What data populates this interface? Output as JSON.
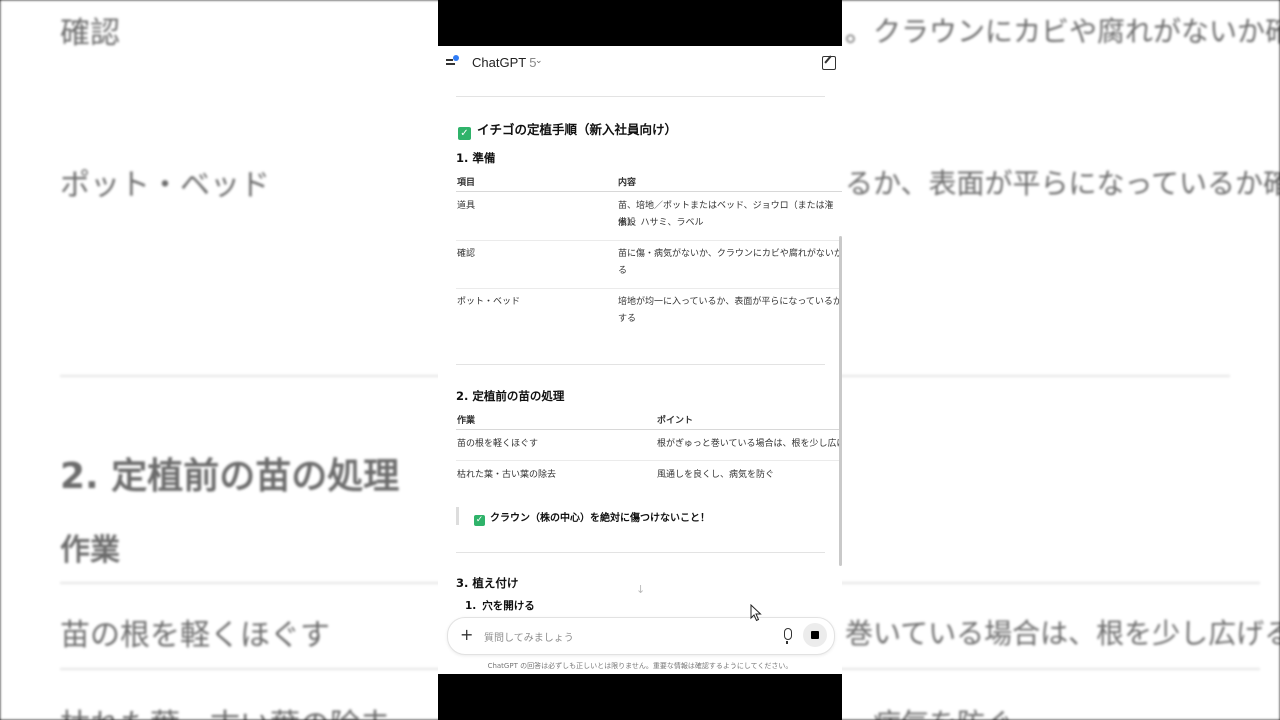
{
  "background": {
    "texts": [
      "確認",
      "ポット・ベッド",
      "2. 定植前の苗の処理",
      "作業",
      "苗の根を軽くほぐす",
      "枯れた葉・古い葉の除去"
    ],
    "right_texts": [
      "。クラウンにカビや腐れがないか確認",
      "るか、表面が平らになっているか確認",
      "巻いている場合は、根を少し広げる",
      "、病気を防ぐ"
    ]
  },
  "app": {
    "title": "ChatGPT",
    "version": "5",
    "menu_icon": "sidebar-menu-icon",
    "edit_icon": "new-chat-icon"
  },
  "doc": {
    "title": "イチゴの定植手順（新入社員向け）",
    "section1": {
      "heading": "1. 準備",
      "headers": [
        "項目",
        "内容"
      ],
      "rows": [
        {
          "item": "道具",
          "content": [
            "苗、培地／ポットまたはベッド、ジョウロ（または潅水設",
            "備）、ハサミ、ラベル"
          ]
        },
        {
          "item": "確認",
          "content": [
            "苗に傷・病気がないか、クラウンにカビや腐れがないか確認す",
            "る"
          ]
        },
        {
          "item": "ポット・ベッド",
          "content": [
            "培地が均一に入っているか、表面が平らになっているか確認",
            "する"
          ]
        }
      ]
    },
    "section2": {
      "heading": "2. 定植前の苗の処理",
      "headers": [
        "作業",
        "ポイント"
      ],
      "rows": [
        {
          "task": "苗の根を軽くほぐす",
          "point": "根がぎゅっと巻いている場合は、根を少し広げる"
        },
        {
          "task": "枯れた葉・古い葉の除去",
          "point": "風通しを良くし、病気を防ぐ"
        }
      ],
      "note": "クラウン（株の中心）を絶対に傷つけないこと！"
    },
    "section3": {
      "heading": "3. 植え付け",
      "items": [
        {
          "num": "1.",
          "label": "穴を開ける"
        }
      ]
    }
  },
  "composer": {
    "placeholder": "質問してみましょう",
    "plus_icon": "plus-icon",
    "mic_icon": "microphone-icon",
    "stop_icon": "stop-icon"
  },
  "disclaimer": "ChatGPT の回答は必ずしも正しいとは限りません。重要な情報は確認するようにしてください。",
  "colors": {
    "check_green": "#2fb36a",
    "menu_dot_blue": "#2f7cf6"
  }
}
